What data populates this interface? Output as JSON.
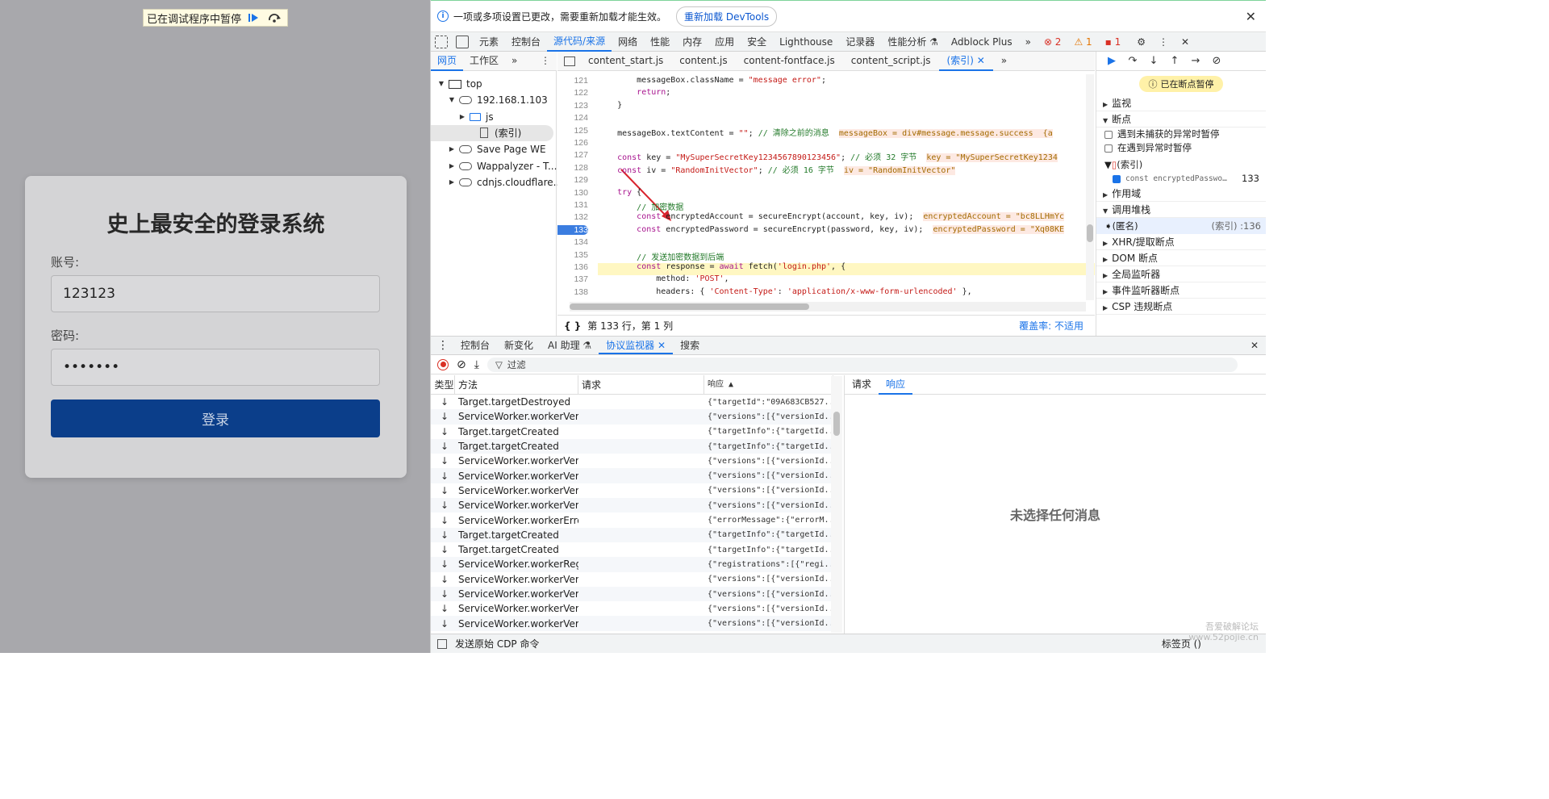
{
  "pause_banner": {
    "text": "已在调试程序中暂停"
  },
  "login": {
    "title": "史上最安全的登录系统",
    "account_label": "账号:",
    "account_value": "123123",
    "password_label": "密码:",
    "password_value": "•••••••",
    "submit_label": "登录"
  },
  "infobar": {
    "message": "一项或多项设置已更改，需要重新加载才能生效。",
    "reload_button": "重新加载 DevTools"
  },
  "main_tabs": [
    "元素",
    "控制台",
    "源代码/来源",
    "网络",
    "性能",
    "内存",
    "应用",
    "安全",
    "Lighthouse",
    "记录器",
    "性能分析 ⚗",
    "Adblock Plus"
  ],
  "main_tab_active": "源代码/来源",
  "badges": {
    "errors": "2",
    "warnings": "1",
    "issues": "1"
  },
  "navigator": {
    "tabs": [
      "网页",
      "工作区"
    ],
    "tree": [
      {
        "label": "top",
        "level": 0,
        "kind": "monitor",
        "open": "▼"
      },
      {
        "label": "192.168.1.103",
        "level": 1,
        "kind": "cloud",
        "open": "▼"
      },
      {
        "label": "js",
        "level": 2,
        "kind": "folder",
        "open": "▶"
      },
      {
        "label": "(索引)",
        "level": 3,
        "kind": "file",
        "open": ""
      },
      {
        "label": "Save Page WE",
        "level": 1,
        "kind": "cloud",
        "open": "▶"
      },
      {
        "label": "Wappalyzer - T...",
        "level": 1,
        "kind": "cloud",
        "open": "▶"
      },
      {
        "label": "cdnjs.cloudflare...",
        "level": 1,
        "kind": "cloud",
        "open": "▶"
      }
    ]
  },
  "file_tabs": [
    "content_start.js",
    "content.js",
    "content-fontface.js",
    "content_script.js",
    "(索引)"
  ],
  "file_tab_active": "(索引)",
  "code_lines": [
    {
      "n": "121",
      "html": "        messageBox.className = <span class=\"str\">\"message error\"</span>;"
    },
    {
      "n": "122",
      "html": "        <span class=\"kw\">return</span>;"
    },
    {
      "n": "123",
      "html": "    }"
    },
    {
      "n": "124",
      "html": ""
    },
    {
      "n": "125",
      "html": "    messageBox.textContent = <span class=\"str\">\"\"</span>; <span class=\"cm\">// 清除之前的消息</span>  <span class=\"val\">messageBox = div#message.message.success  {a</span>"
    },
    {
      "n": "126",
      "html": ""
    },
    {
      "n": "127",
      "html": "    <span class=\"kw\">const</span> key = <span class=\"str\">\"MySuperSecretKey1234567890123456\"</span>; <span class=\"cm\">// 必须 32 字节</span>  <span class=\"val\">key = \"MySuperSecretKey1234</span>"
    },
    {
      "n": "128",
      "html": "    <span class=\"kw\">const</span> iv = <span class=\"str\">\"RandomInitVector\"</span>; <span class=\"cm\">// 必须 16 字节</span>  <span class=\"val\">iv = \"RandomInitVector\"</span>"
    },
    {
      "n": "129",
      "html": ""
    },
    {
      "n": "130",
      "html": "    <span class=\"kw\">try</span> {"
    },
    {
      "n": "131",
      "html": "        <span class=\"cm\">// 加密数据</span>"
    },
    {
      "n": "132",
      "html": "        <span class=\"kw\">const</span> encryptedAccount = secureEncrypt(account, key, iv);  <span class=\"val\">encryptedAccount = \"bc8LLHmYc</span>"
    },
    {
      "n": "133",
      "html": "        <span class=\"kw\">const</span> encryptedPassword = secureEncrypt(password, key, iv);  <span class=\"val\">encryptedPassword = \"Xq08KE</span>"
    },
    {
      "n": "134",
      "html": ""
    },
    {
      "n": "135",
      "html": "        <span class=\"cm\">// 发送加密数据到后端</span>"
    },
    {
      "n": "136",
      "html": "        <span class=\"kw\">const</span> response = <span class=\"kw\">await</span> fetch(<span class=\"str\">'login.php'</span>, {"
    },
    {
      "n": "137",
      "html": "            method: <span class=\"str\">'POST'</span>,"
    },
    {
      "n": "138",
      "html": "            headers: { <span class=\"str\">'Content-Type'</span>: <span class=\"str\">'application/x-www-form-urlencoded'</span> },"
    }
  ],
  "status": {
    "position": "第 133 行，第 1 列",
    "coverage": "覆盖率: 不适用"
  },
  "debugger": {
    "paused": "已在断点暂停",
    "sections": [
      {
        "label": "监视",
        "tri": "▶"
      },
      {
        "label": "断点",
        "tri": "▼"
      }
    ],
    "checks": [
      "遇到未捕获的异常时暂停",
      "在遇到异常时暂停"
    ],
    "bp_file": "(索引)",
    "bp_line_text": "const encryptedPasswo…",
    "bp_line_no": "133",
    "sections2": [
      {
        "label": "作用域",
        "tri": "▶"
      },
      {
        "label": "调用堆栈",
        "tri": "▼"
      }
    ],
    "callstack_name": "(匿名)",
    "callstack_loc": "(索引) :136",
    "sections3": [
      {
        "label": "XHR/提取断点",
        "tri": "▶"
      },
      {
        "label": "DOM 断点",
        "tri": "▶"
      },
      {
        "label": "全局监听器",
        "tri": "▶"
      },
      {
        "label": "事件监听器断点",
        "tri": "▶"
      },
      {
        "label": "CSP 违规断点",
        "tri": "▶"
      }
    ]
  },
  "drawer_tabs": [
    "控制台",
    "新变化",
    "AI 助理 ⚗",
    "协议监视器",
    "搜索"
  ],
  "drawer_active": "协议监视器",
  "filter_placeholder": "过滤",
  "protocol": {
    "headers": [
      "类型",
      "方法",
      "请求",
      "响应"
    ],
    "rows": [
      {
        "t": "↓",
        "m": "Target.targetDestroyed",
        "r": "{\"targetId\":\"09A683CB527..."
      },
      {
        "t": "↓",
        "m": "ServiceWorker.workerVers...",
        "r": "{\"versions\":[{\"versionId..."
      },
      {
        "t": "↓",
        "m": "Target.targetCreated",
        "r": "{\"targetInfo\":{\"targetId..."
      },
      {
        "t": "↓",
        "m": "Target.targetCreated",
        "r": "{\"targetInfo\":{\"targetId..."
      },
      {
        "t": "↓",
        "m": "ServiceWorker.workerVers...",
        "r": "{\"versions\":[{\"versionId..."
      },
      {
        "t": "↓",
        "m": "ServiceWorker.workerVers...",
        "r": "{\"versions\":[{\"versionId..."
      },
      {
        "t": "↓",
        "m": "ServiceWorker.workerVers...",
        "r": "{\"versions\":[{\"versionId..."
      },
      {
        "t": "↓",
        "m": "ServiceWorker.workerVers...",
        "r": "{\"versions\":[{\"versionId..."
      },
      {
        "t": "↓",
        "m": "ServiceWorker.workerErro...",
        "r": "{\"errorMessage\":{\"errorM..."
      },
      {
        "t": "↓",
        "m": "Target.targetCreated",
        "r": "{\"targetInfo\":{\"targetId..."
      },
      {
        "t": "↓",
        "m": "Target.targetCreated",
        "r": "{\"targetInfo\":{\"targetId..."
      },
      {
        "t": "↓",
        "m": "ServiceWorker.workerRegi...",
        "r": "{\"registrations\":[{\"regi..."
      },
      {
        "t": "↓",
        "m": "ServiceWorker.workerVers...",
        "r": "{\"versions\":[{\"versionId..."
      },
      {
        "t": "↓",
        "m": "ServiceWorker.workerVers...",
        "r": "{\"versions\":[{\"versionId..."
      },
      {
        "t": "↓",
        "m": "ServiceWorker.workerVers...",
        "r": "{\"versions\":[{\"versionId..."
      },
      {
        "t": "↓",
        "m": "ServiceWorker.workerVers...",
        "r": "{\"versions\":[{\"versionId..."
      }
    ]
  },
  "response_tabs": [
    "请求",
    "响应"
  ],
  "response_active": "响应",
  "no_message": "未选择任何消息",
  "bottom": {
    "cdp": "发送原始 CDP 命令",
    "target": "标签页 ()"
  },
  "watermark": [
    "吾爱破解论坛",
    "www.52pojie.cn"
  ]
}
